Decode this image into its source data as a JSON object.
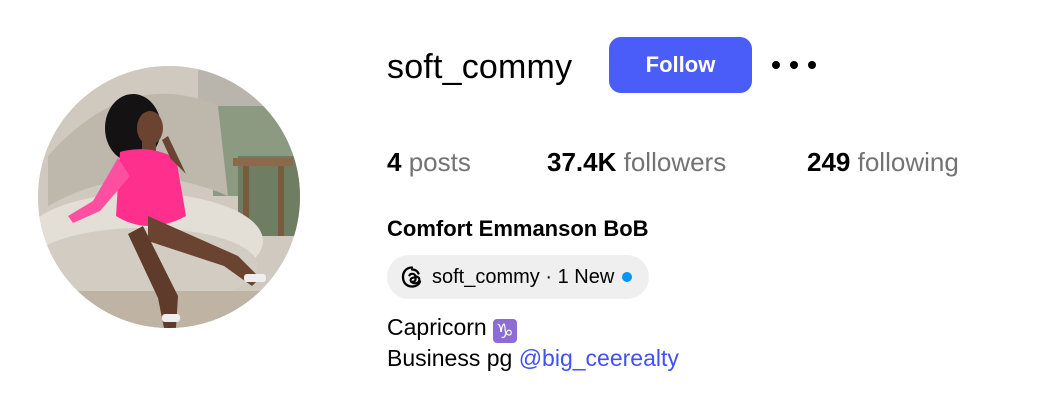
{
  "profile": {
    "username": "soft_commy",
    "full_name": "Comfort Emmanson BoB",
    "follow_label": "Follow",
    "more_options_icon": "more-horizontal-icon"
  },
  "stats": {
    "posts_count": "4",
    "posts_label": "posts",
    "followers_count": "37.4K",
    "followers_label": "followers",
    "following_count": "249",
    "following_label": "following"
  },
  "threads_badge": {
    "icon": "threads-icon",
    "text": "soft_commy · 1 New"
  },
  "bio": {
    "line1_text": "Capricorn",
    "zodiac_symbol": "♑",
    "line2_text": "Business pg",
    "link_text": "@big_ceerealty"
  },
  "colors": {
    "follow_button_bg": "#4a5df9",
    "link": "#4150f7",
    "new_dot": "#0095f6",
    "zodiac_bg": "#8e6cd6"
  }
}
